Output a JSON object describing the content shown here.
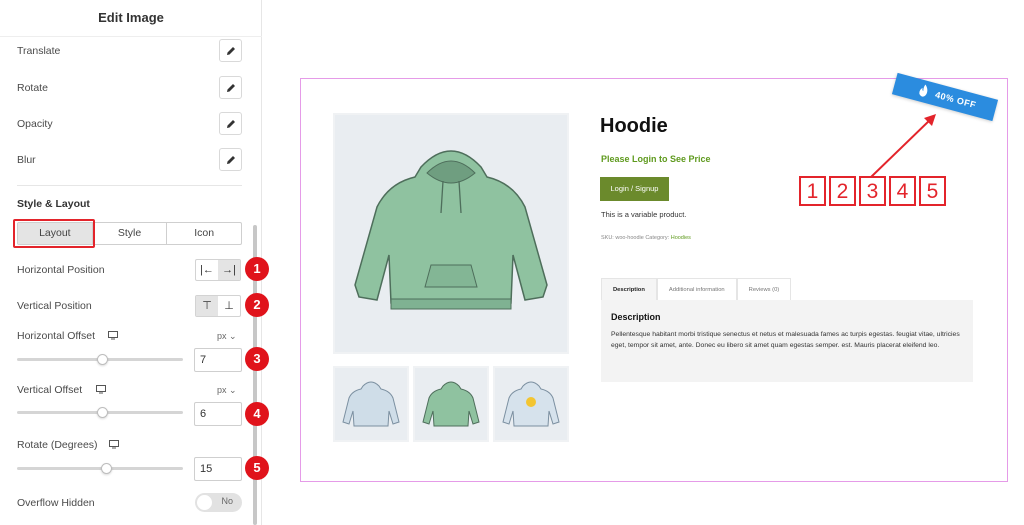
{
  "panel": {
    "title": "Edit Image",
    "rows": [
      {
        "label": "Translate"
      },
      {
        "label": "Rotate"
      },
      {
        "label": "Opacity"
      },
      {
        "label": "Blur"
      }
    ],
    "section_title": "Style & Layout",
    "tabs": [
      "Layout",
      "Style",
      "Icon"
    ],
    "active_tab": "Layout",
    "horizontal_position": {
      "label": "Horizontal Position",
      "options": [
        "|←",
        "→|"
      ],
      "selected": 1
    },
    "vertical_position": {
      "label": "Vertical Position",
      "options": [
        "⊤",
        "⊥"
      ],
      "selected": 0
    },
    "horizontal_offset": {
      "label": "Horizontal Offset",
      "unit": "px",
      "value": "7",
      "fraction": 0.52
    },
    "vertical_offset": {
      "label": "Vertical Offset",
      "unit": "px",
      "value": "6",
      "fraction": 0.52
    },
    "rotate_degrees": {
      "label": "Rotate (Degrees)",
      "value": "15",
      "fraction": 0.54
    },
    "overflow_hidden": {
      "label": "Overflow Hidden",
      "toggle_text": "No"
    },
    "badges": [
      "1",
      "2",
      "3",
      "4",
      "5"
    ]
  },
  "preview": {
    "product_title": "Hoodie",
    "login_text": "Please Login to See Price",
    "login_button": "Login / Signup",
    "variable_text": "This is a variable product.",
    "sku_prefix": "SKU: woo-hoodie Category:",
    "sku_category": "Hoodies",
    "tabs": [
      "Description",
      "Additional information",
      "Reviews (0)"
    ],
    "desc_title": "Description",
    "desc_body": "Pellentesque habitant morbi tristique senectus et netus et malesuada fames ac turpis egestas. feugiat vitae, ultricies eget, tempor sit amet, ante. Donec eu libero sit amet quam egestas semper. est. Mauris placerat eleifend leo.",
    "ribbon_text": "40% OFF",
    "ribbon_color": "#2b8cdf",
    "annotation_numbers": [
      "1",
      "2",
      "3",
      "4",
      "5"
    ]
  },
  "colors": {
    "accent_red": "#e3242b",
    "login_green": "#5f9a1e",
    "hoodie_main": "#8fc2a0"
  }
}
